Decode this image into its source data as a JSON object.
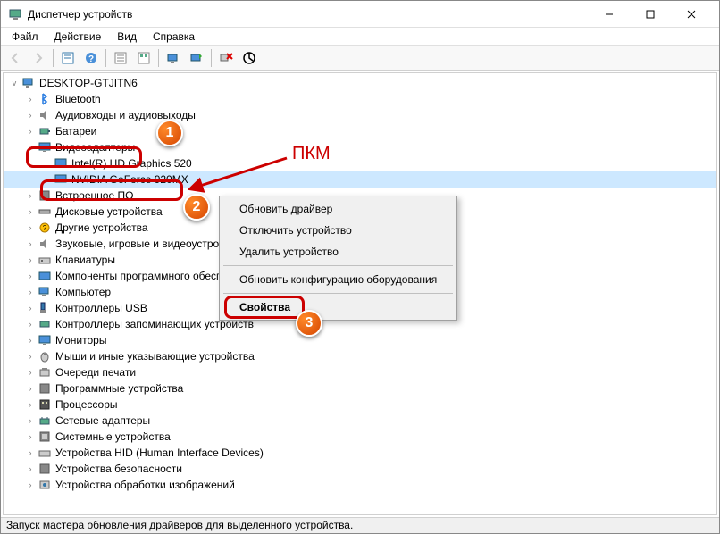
{
  "window": {
    "title": "Диспетчер устройств"
  },
  "menu": {
    "file": "Файл",
    "action": "Действие",
    "view": "Вид",
    "help": "Справка"
  },
  "tree": {
    "root": "DESKTOP-GTJITN6",
    "items": [
      "Bluetooth",
      "Аудиовходы и аудиовыходы",
      "Батареи"
    ],
    "video": {
      "label": "Видеоадаптеры",
      "children": [
        "Intel(R) HD Graphics 520",
        "NVIDIA GeForce 920MX"
      ]
    },
    "rest": [
      "Встроенное ПО",
      "Дисковые устройства",
      "Другие устройства",
      "Звуковые, игровые и видеоустройства",
      "Клавиатуры",
      "Компоненты программного обеспечения",
      "Компьютер",
      "Контроллеры USB",
      "Контроллеры запоминающих устройств",
      "Мониторы",
      "Мыши и иные указывающие устройства",
      "Очереди печати",
      "Программные устройства",
      "Процессоры",
      "Сетевые адаптеры",
      "Системные устройства",
      "Устройства HID (Human Interface Devices)",
      "Устройства безопасности",
      "Устройства обработки изображений"
    ]
  },
  "context": {
    "update": "Обновить драйвер",
    "disable": "Отключить устройство",
    "uninstall": "Удалить устройство",
    "scan": "Обновить конфигурацию оборудования",
    "properties": "Свойства"
  },
  "annotations": {
    "pkm": "ПКМ",
    "b1": "1",
    "b2": "2",
    "b3": "3"
  },
  "statusbar": "Запуск мастера обновления драйверов для выделенного устройства."
}
